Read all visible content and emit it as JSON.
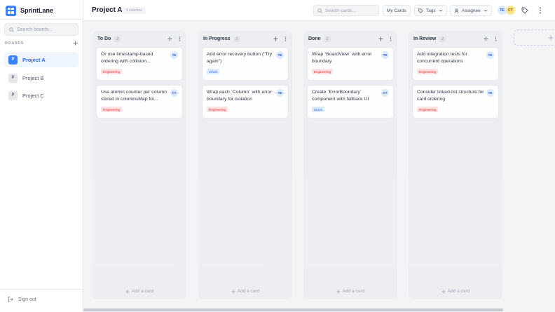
{
  "app": {
    "name": "SprintLane"
  },
  "sidebar": {
    "search_placeholder": "Search boards...",
    "boards_heading": "BOARDS",
    "boards": [
      {
        "initial": "P",
        "name": "Project A",
        "active": true
      },
      {
        "initial": "P",
        "name": "Project B",
        "active": false
      },
      {
        "initial": "P",
        "name": "Project C",
        "active": false
      }
    ],
    "sign_out": "Sign out"
  },
  "header": {
    "title": "Project A",
    "columns_badge": "4 columns",
    "search_placeholder": "Search cards...",
    "my_cards": "My Cards",
    "tags": "Tags",
    "assignee": "Assignee",
    "avatars": [
      "TE",
      "CT"
    ]
  },
  "columns": [
    {
      "title": "To Do",
      "count": "2",
      "cards": [
        {
          "title": "Or use timestamp-based ordering with collision...",
          "avatar": "TE",
          "tag": "Engineering"
        },
        {
          "title": "Use atomic counter per column stored in columnsMap for...",
          "avatar": "CT",
          "tag": "Engineering"
        }
      ],
      "add_label": "Add a card"
    },
    {
      "title": "In Progress",
      "count": "2",
      "cards": [
        {
          "title": "Add error recovery button (\"Try again\")",
          "avatar": "TE",
          "tag": "UI/UX"
        },
        {
          "title": "Wrap each `Column` with error boundary for isolation",
          "avatar": "TE",
          "tag": "Engineering"
        }
      ],
      "add_label": "Add a card"
    },
    {
      "title": "Done",
      "count": "2",
      "cards": [
        {
          "title": "Wrap `BoardView` with error boundary",
          "avatar": "TE",
          "tag": "Engineering"
        },
        {
          "title": "Create `ErrorBoundary` component with fallback UI",
          "avatar": "CT",
          "tag": "UI/UX"
        }
      ],
      "add_label": "Add a card"
    },
    {
      "title": "In Review",
      "count": "2",
      "cards": [
        {
          "title": "Add integration tests for concurrent operations",
          "avatar": "TE",
          "tag": "Engineering"
        },
        {
          "title": "Consider linked-list structure for card ordering",
          "avatar": "TE",
          "tag": "Engineering"
        }
      ],
      "add_label": "Add a card"
    }
  ],
  "colors": {
    "accent": "#3b82f6",
    "engineering_tag": "#dc2626",
    "uiux_tag": "#2563eb"
  }
}
